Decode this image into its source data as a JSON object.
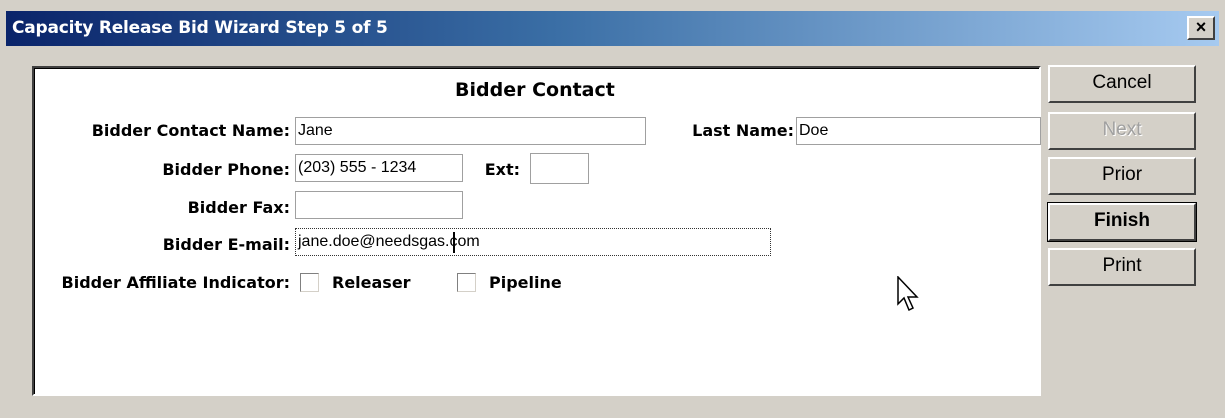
{
  "window": {
    "title": "Capacity Release Bid Wizard Step 5 of 5",
    "close_label": "×"
  },
  "form": {
    "section_title": "Bidder Contact",
    "contact_name_label": "Bidder Contact Name:",
    "contact_name_value": "Jane",
    "last_name_label": "Last Name:",
    "last_name_value": "Doe",
    "phone_label": "Bidder Phone:",
    "phone_value": "(203) 555 - 1234",
    "ext_label": "Ext:",
    "ext_value": "",
    "fax_label": "Bidder Fax:",
    "fax_value": "",
    "email_label": "Bidder E-mail:",
    "email_value": "jane.doe@needsgas.com",
    "affiliate_label": "Bidder Affiliate Indicator:",
    "releaser_label": "Releaser",
    "releaser_checked": false,
    "pipeline_label": "Pipeline",
    "pipeline_checked": false
  },
  "buttons": {
    "cancel": "Cancel",
    "next": "Next",
    "prior": "Prior",
    "finish": "Finish",
    "print": "Print"
  },
  "icons": {
    "cursor": "mouse-pointer-icon",
    "close": "close-icon"
  }
}
